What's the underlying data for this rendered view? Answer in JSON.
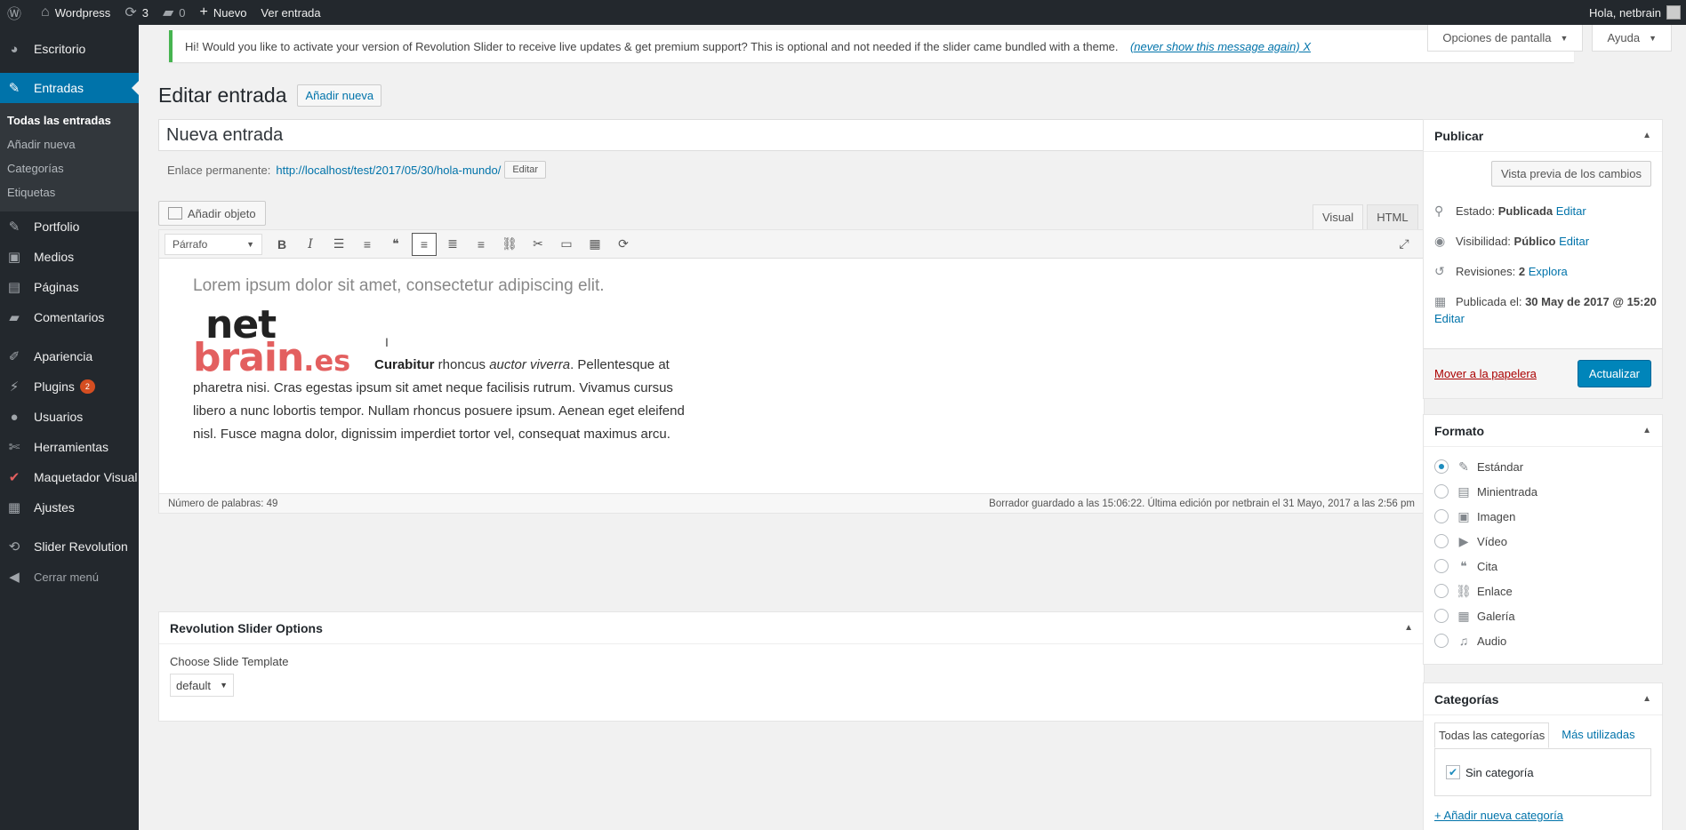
{
  "adminbar": {
    "site_name": "Wordpress",
    "updates_count": "3",
    "comments_count": "0",
    "new_label": "Nuevo",
    "view_label": "Ver entrada",
    "greeting": "Hola, netbrain"
  },
  "sidebar": {
    "items": [
      {
        "label": "Escritorio",
        "icon": "dashboard-icon"
      },
      {
        "label": "Entradas",
        "icon": "pin-icon"
      },
      {
        "label": "Portfolio",
        "icon": "portfolio-icon"
      },
      {
        "label": "Medios",
        "icon": "media-icon"
      },
      {
        "label": "Páginas",
        "icon": "pages-icon"
      },
      {
        "label": "Comentarios",
        "icon": "comments-icon"
      },
      {
        "label": "Apariencia",
        "icon": "appearance-icon"
      },
      {
        "label": "Plugins",
        "icon": "plugins-icon",
        "badge": "2"
      },
      {
        "label": "Usuarios",
        "icon": "users-icon"
      },
      {
        "label": "Herramientas",
        "icon": "tools-icon"
      },
      {
        "label": "Maquetador Visual",
        "icon": "builder-icon"
      },
      {
        "label": "Ajustes",
        "icon": "settings-icon"
      },
      {
        "label": "Slider Revolution",
        "icon": "slider-icon"
      },
      {
        "label": "Cerrar menú",
        "icon": "collapse-icon"
      }
    ],
    "submenu": [
      "Todas las entradas",
      "Añadir nueva",
      "Categorías",
      "Etiquetas"
    ]
  },
  "notice": {
    "text": "Hi! Would you like to activate your version of Revolution Slider to receive live updates & get premium support? This is optional and not needed if the slider came bundled with a theme.",
    "dismiss": "(never show this message again)  X"
  },
  "screen": {
    "options": "Opciones de pantalla",
    "help": "Ayuda"
  },
  "page": {
    "title": "Editar entrada",
    "add_new": "Añadir nueva",
    "post_title": "Nueva entrada",
    "permalink_label": "Enlace permanente:",
    "permalink_url": "http://localhost/test/2017/05/30/hola-mundo/",
    "permalink_edit": "Editar",
    "add_media": "Añadir objeto"
  },
  "editor": {
    "tab_visual": "Visual",
    "tab_html": "HTML",
    "format_select": "Párrafo",
    "lead": "Lorem ipsum dolor sit amet, consectetur adipiscing elit.",
    "logo_top": "net",
    "logo_bottom": "brain",
    "logo_tld": ".es",
    "body_bold": "Curabitur",
    "body_1": " rhoncus ",
    "body_italic": "auctor viverra",
    "body_2": ". Pellentesque at pharetra nisi. Cras egestas ipsum sit amet neque facilisis rutrum. Vivamus cursus libero a nunc lobortis tempor. Nullam rhoncus posuere ipsum. Aenean eget eleifend nisl. Fusce magna dolor, dignissim imperdiet tortor vel, consequat maximus arcu.",
    "word_count": "Número de palabras: 49",
    "autosave": "Borrador guardado a las 15:06:22. Última edición por netbrain el 31 Mayo, 2017 a las 2:56 pm"
  },
  "revslider": {
    "title": "Revolution Slider Options",
    "label": "Choose Slide Template",
    "value": "default"
  },
  "publish": {
    "title": "Publicar",
    "preview": "Vista previa de los cambios",
    "status_label": "Estado:",
    "status_value": "Publicada",
    "visibility_label": "Visibilidad:",
    "visibility_value": "Público",
    "revisions_label": "Revisiones:",
    "revisions_value": "2",
    "revisions_link": "Explora",
    "published_label": "Publicada el:",
    "published_value": "30 May de 2017 @ 15:20",
    "edit": "Editar",
    "trash": "Mover a la papelera",
    "update": "Actualizar"
  },
  "format": {
    "title": "Formato",
    "options": [
      {
        "label": "Estándar",
        "icon": "pin-icon",
        "checked": true
      },
      {
        "label": "Minientrada",
        "icon": "aside-icon",
        "checked": false
      },
      {
        "label": "Imagen",
        "icon": "image-icon",
        "checked": false
      },
      {
        "label": "Vídeo",
        "icon": "video-icon",
        "checked": false
      },
      {
        "label": "Cita",
        "icon": "quote-icon",
        "checked": false
      },
      {
        "label": "Enlace",
        "icon": "link-icon",
        "checked": false
      },
      {
        "label": "Galería",
        "icon": "gallery-icon",
        "checked": false
      },
      {
        "label": "Audio",
        "icon": "audio-icon",
        "checked": false
      }
    ]
  },
  "categories": {
    "title": "Categorías",
    "tab_all": "Todas las categorías",
    "tab_popular": "Más utilizadas",
    "item": "Sin categoría",
    "add_new": "+ Añadir nueva categoría"
  }
}
